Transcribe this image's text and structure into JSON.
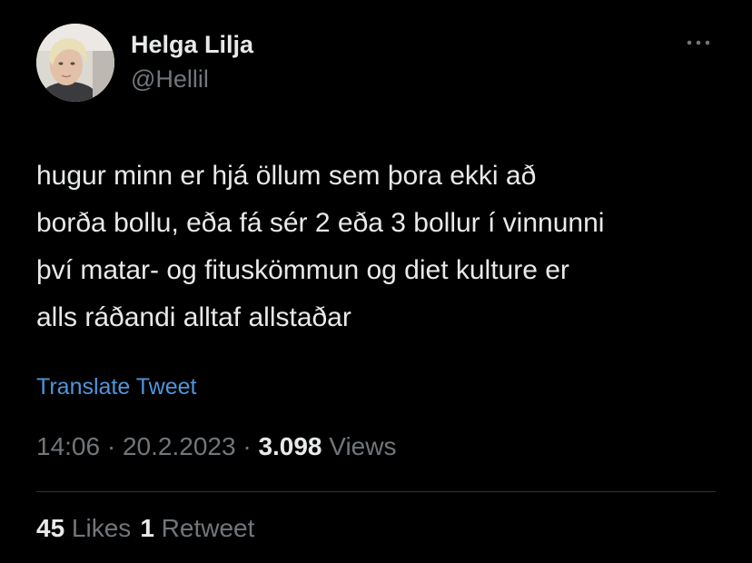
{
  "author": {
    "display_name": "Helga Lilja",
    "handle": "@Hellil"
  },
  "tweet": {
    "lines": [
      "hugur minn er hjá öllum sem þora ekki að",
      "borða bollu, eða fá sér 2 eða 3 bollur í vinnunni",
      "því matar- og fituskömmun og diet kulture er",
      "alls ráðandi alltaf allstaðar"
    ]
  },
  "translate_label": "Translate Tweet",
  "meta": {
    "time": "14:06",
    "sep1": " · ",
    "date": "20.2.2023",
    "sep2": " · ",
    "views_count": "3.098",
    "views_label": " Views"
  },
  "stats": {
    "likes_count": "45",
    "likes_label": " Likes",
    "retweets_count": "1",
    "retweets_label": " Retweet"
  },
  "colors": {
    "background": "#000000",
    "primary_text": "#e7e9ea",
    "secondary_text": "#71767b",
    "link": "#4f95da",
    "divider": "#2f3336"
  },
  "icons": {
    "more": "more-horizontal-icon",
    "avatar": "profile-photo"
  }
}
